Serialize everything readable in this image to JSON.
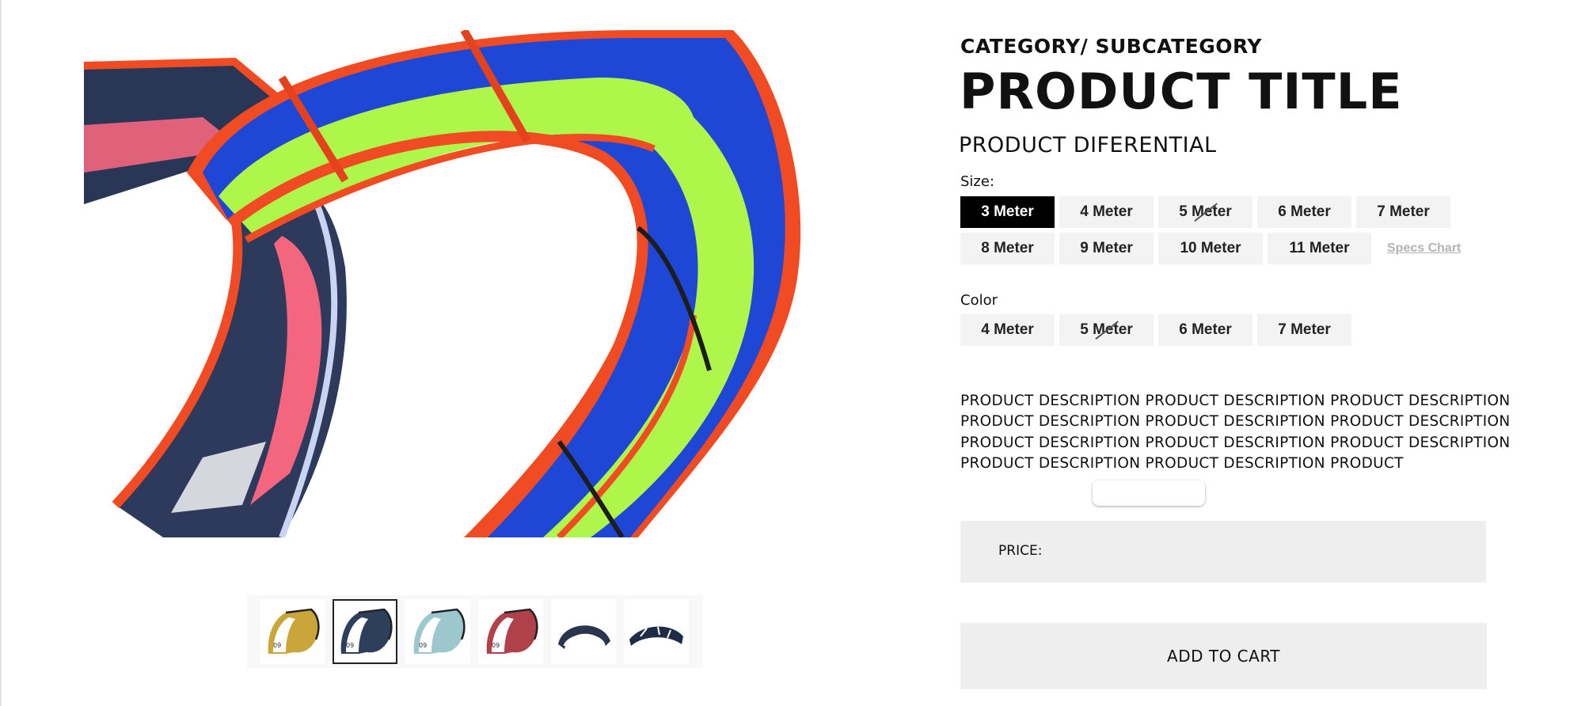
{
  "product": {
    "category": "CATEGORY/ SUBCATEGORY",
    "title": "PRODUCT TITLE",
    "differential": "PRODUCT DIFERENTIAL",
    "description": "PRODUCT DESCRIPTION PRODUCT DESCRIPTION PRODUCT DESCRIPTION PRODUCT DESCRIPTION PRODUCT DESCRIPTION PRODUCT DESCRIPTION PRODUCT DESCRIPTION PRODUCT DESCRIPTION PRODUCT DESCRIPTION PRODUCT DESCRIPTION PRODUCT DESCRIPTION PRODUCT"
  },
  "size": {
    "label": "Size:",
    "options": [
      "3 Meter",
      "4 Meter",
      "5 Meter",
      "6 Meter",
      "7 Meter",
      "8 Meter",
      "9 Meter",
      "10 Meter",
      "11 Meter"
    ],
    "selected": "3 Meter",
    "unavailable": [
      "5 Meter"
    ],
    "specs_link": "Specs Chart"
  },
  "color": {
    "label": "Color",
    "options": [
      "4 Meter",
      "5 Meter",
      "6 Meter",
      "7 Meter"
    ],
    "unavailable": [
      "5 Meter"
    ]
  },
  "price": {
    "label": "PRICE:"
  },
  "cart": {
    "button_label": "ADD TO CART"
  },
  "gallery": {
    "thumbnails": [
      {
        "icon": "kite-yellow-thumbnail",
        "accent": "#c9a53a",
        "badge": "09"
      },
      {
        "icon": "kite-navy-thumbnail",
        "accent": "#2e3f5c",
        "badge": "09"
      },
      {
        "icon": "kite-teal-thumbnail",
        "accent": "#9cc7cc",
        "badge": "09"
      },
      {
        "icon": "kite-red-thumbnail",
        "accent": "#b0404a",
        "badge": "09"
      },
      {
        "icon": "kite-arc-thumbnail",
        "accent": "#2b3550"
      },
      {
        "icon": "kite-wing-thumbnail",
        "accent": "#1e2d47"
      }
    ],
    "active_index": 1
  },
  "colors": {
    "kite_blue": "#1e47d6",
    "kite_lime": "#aef64a",
    "kite_orange": "#f04b22",
    "kite_pink": "#f4667e",
    "kite_navy": "#10182b",
    "panel_gray": "#eeeeee",
    "option_gray": "#f3f3f3",
    "selected_black": "#000000"
  }
}
